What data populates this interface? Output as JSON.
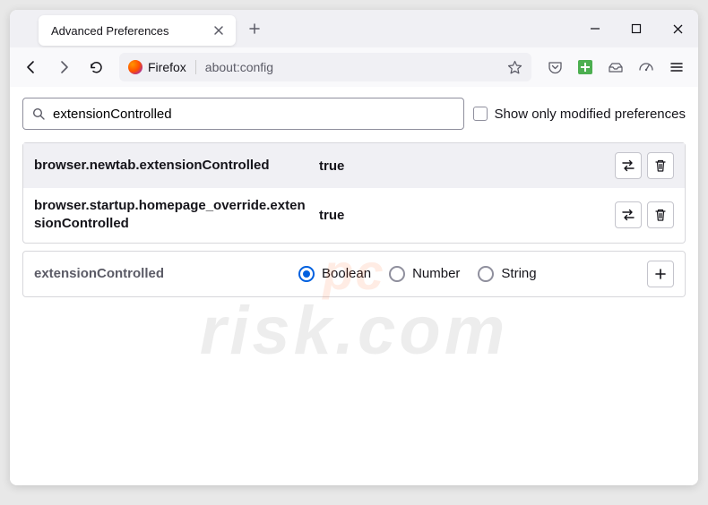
{
  "window": {
    "tab_title": "Advanced Preferences",
    "identity_label": "Firefox",
    "url": "about:config"
  },
  "search": {
    "value": "extensionControlled",
    "placeholder": "",
    "show_modified_label": "Show only modified preferences",
    "show_modified_checked": false
  },
  "prefs": [
    {
      "name": "browser.newtab.extensionControlled",
      "value": "true"
    },
    {
      "name": "browser.startup.homepage_override.extensionControlled",
      "value": "true"
    }
  ],
  "new_pref": {
    "name": "extensionControlled",
    "types": [
      "Boolean",
      "Number",
      "String"
    ],
    "selected_index": 0
  },
  "watermark": {
    "line1": "pc",
    "line2": "risk.com"
  }
}
